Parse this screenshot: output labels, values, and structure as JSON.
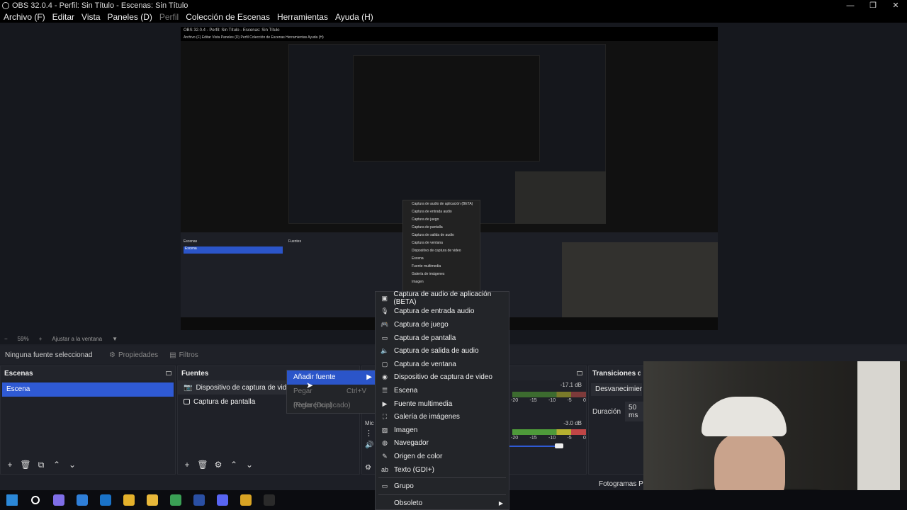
{
  "window": {
    "title": "OBS 32.0.4 - Perfil: Sin Título - Escenas: Sin Título",
    "controls": [
      "—",
      "❐",
      "✕"
    ]
  },
  "menubar": [
    {
      "label": "Archivo (F)",
      "disabled": false
    },
    {
      "label": "Editar",
      "disabled": false
    },
    {
      "label": "Vista",
      "disabled": false
    },
    {
      "label": "Paneles (D)",
      "disabled": false
    },
    {
      "label": "Perfil",
      "disabled": true
    },
    {
      "label": "Colección de Escenas",
      "disabled": false
    },
    {
      "label": "Herramientas",
      "disabled": false
    },
    {
      "label": "Ayuda (H)",
      "disabled": false
    }
  ],
  "preview": {
    "nested_title": "OBS 32.0.4 - Perfil: Sin Título - Escenas: Sin Título",
    "nested_menu": "Archivo (F)   Editar   Vista   Paneles (D)   Perfil   Colección de Escenas   Herramientas   Ayuda (H)",
    "nested_scene": "Escena",
    "nested_scenes_header": "Escenas",
    "nested_sources_header": "Fuentes",
    "nested_menu_items": [
      "Captura de audio de aplicación (BETA)",
      "Captura de entrada audio",
      "Captura de juego",
      "Captura de pantalla",
      "Captura de salida de audio",
      "Captura de ventana",
      "Dispositivo de captura de video",
      "Escena",
      "Fuente multimedia",
      "Galería de imágenes",
      "Imagen"
    ]
  },
  "zoom": {
    "minus": "−",
    "value": "59%",
    "plus": "+",
    "fit": "Ajustar a la ventana",
    "arrow": "▼"
  },
  "props": {
    "no_selection": "Ninguna fuente seleccionad",
    "properties": "Propiedades",
    "filters": "Filtros"
  },
  "scenes": {
    "header": "Escenas",
    "items": [
      "Escena"
    ],
    "footer": [
      "+",
      "🗑",
      "⧉",
      "⌃",
      "⌄"
    ]
  },
  "sources": {
    "header": "Fuentes",
    "items": [
      "Dispositivo de captura de video",
      "Captura de pantalla"
    ],
    "footer": [
      "+",
      "🗑",
      "⚙",
      "⌃",
      "⌄"
    ]
  },
  "mixer": {
    "label": "Mic",
    "tracks": [
      {
        "db": "-17.1 dB",
        "ticks": [
          "-20",
          "-15",
          "-10",
          "-5",
          "0"
        ]
      },
      {
        "db": "-3.0 dB",
        "ticks": [
          "-20",
          "-15",
          "-10",
          "-5",
          "0"
        ]
      }
    ],
    "volume_level": 0.85
  },
  "transitions": {
    "header": "Transiciones de e",
    "selected": "Desvanecimiento",
    "duration_label": "Duración",
    "duration_value": "50 ms"
  },
  "status": {
    "frames": "Fotogramas Per"
  },
  "context_menu": {
    "items": [
      {
        "label": "Añadir fuente",
        "highlight": true,
        "submenu": true,
        "shortcut": ""
      },
      {
        "label": "Pegar (Referencia)",
        "disabled": true,
        "shortcut": "Ctrl+V"
      },
      {
        "label": "Pegar (Duplicado)",
        "disabled": true,
        "shortcut": ""
      }
    ]
  },
  "add_source_menu": {
    "items": [
      {
        "label": "Captura de audio de aplicación (BETA)",
        "icon": "app-audio-icon"
      },
      {
        "label": "Captura de entrada audio",
        "icon": "microphone-icon"
      },
      {
        "label": "Captura de juego",
        "icon": "gamepad-icon"
      },
      {
        "label": "Captura de pantalla",
        "icon": "monitor-icon"
      },
      {
        "label": "Captura de salida de audio",
        "icon": "speaker-icon"
      },
      {
        "label": "Captura de ventana",
        "icon": "window-icon"
      },
      {
        "label": "Dispositivo de captura de video",
        "icon": "camera-icon"
      },
      {
        "label": "Escena",
        "icon": "list-icon"
      },
      {
        "label": "Fuente multimedia",
        "icon": "play-icon"
      },
      {
        "label": "Galería de imágenes",
        "icon": "gallery-icon"
      },
      {
        "label": "Imagen",
        "icon": "image-icon"
      },
      {
        "label": "Navegador",
        "icon": "globe-icon"
      },
      {
        "label": "Origen de color",
        "icon": "brush-icon"
      },
      {
        "label": "Texto (GDI+)",
        "icon": "text-icon"
      }
    ],
    "group": {
      "label": "Grupo",
      "icon": "folder-icon"
    },
    "obsolete": {
      "label": "Obsoleto",
      "arrow": "▶"
    }
  },
  "taskbar": {
    "icons": [
      "windows-start-icon",
      "search-icon",
      "copilot-icon",
      "store-icon",
      "outlook-icon",
      "chrome-icon",
      "file-explorer-icon",
      "chrome-profile-icon",
      "steam-icon",
      "discord-icon",
      "winamp-icon",
      "obs-icon"
    ],
    "colors": [
      "#2b88d8",
      "#ffffff",
      "#7f6ee8",
      "#2f7fd8",
      "#1a73c8",
      "#e4b12b",
      "#e8b83a",
      "#3aa055",
      "#2a4fa3",
      "#5865f2",
      "#d9a424",
      "#2a2a2a"
    ]
  },
  "colors": {
    "accent": "#2f5ad4",
    "background": "#1d1f26",
    "menu": "#232529"
  }
}
